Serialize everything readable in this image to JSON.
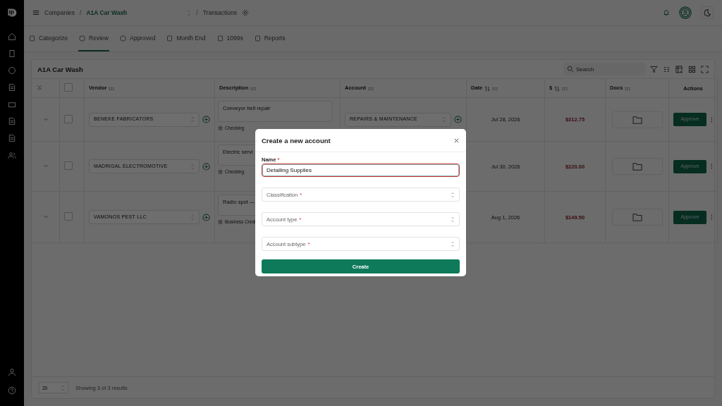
{
  "breadcrumb": {
    "root": "Companies",
    "separators": [
      "/",
      "/"
    ],
    "company": "A1A Car Wash",
    "page": "Transactions"
  },
  "tabs": [
    {
      "label": "Categorize",
      "selected": false
    },
    {
      "label": "Review",
      "selected": true
    },
    {
      "label": "Approved",
      "selected": false
    },
    {
      "label": "Month End",
      "selected": false
    },
    {
      "label": "1099s",
      "selected": false
    },
    {
      "label": "Reports",
      "selected": false
    }
  ],
  "card": {
    "title": "A1A Car Wash",
    "search": {
      "placeholder": "Search"
    }
  },
  "table": {
    "header_checkbox": {
      "checked": false
    },
    "columns": [
      {
        "label": "Vendor",
        "sortable": false,
        "grip": true
      },
      {
        "label": "Description",
        "sortable": false,
        "grip": true
      },
      {
        "label": "Account",
        "sortable": false,
        "grip": true
      },
      {
        "label": "Date",
        "sortable": true,
        "grip": true
      },
      {
        "label": "$",
        "sortable": true,
        "grip": true
      },
      {
        "label": "Docs",
        "sortable": false,
        "grip": true
      },
      {
        "label": "Actions",
        "sortable": false,
        "grip": false
      }
    ],
    "rows": [
      {
        "checked": false,
        "vendor": "BENEKE FABRICATORS",
        "description": "Conveyor belt repair",
        "bank": "Checking",
        "account": "REPAIRS & MAINTENANCE",
        "date": "Jul 28, 2026",
        "amount": "$312.75",
        "action": "Approve"
      },
      {
        "checked": false,
        "vendor": "MADRIGAL ELECTROMOTIVE",
        "description": "Electric servi",
        "bank": "Checking",
        "date": "Jul 30, 2026",
        "amount": "$220.00",
        "action": "Approve"
      },
      {
        "checked": false,
        "vendor": "VAMONOS PEST LLC",
        "description": "Radio spot —",
        "bank": "Business Credi",
        "date": "Aug 1, 2026",
        "amount": "$149.50",
        "action": "Approve"
      }
    ]
  },
  "footer": {
    "page_size": "20",
    "summary": "Showing 3 of 3 results"
  },
  "modal": {
    "title": "Create a new account",
    "fields": [
      {
        "kind": "text",
        "label": "Name",
        "mark": "*",
        "value": "Detailing Supplies",
        "error": true
      },
      {
        "kind": "select",
        "label": "Classification",
        "mark": "*"
      },
      {
        "kind": "select",
        "label": "Account type",
        "mark": "*"
      },
      {
        "kind": "select",
        "label": "Account subtype",
        "mark": "*"
      }
    ],
    "button": "Create"
  }
}
